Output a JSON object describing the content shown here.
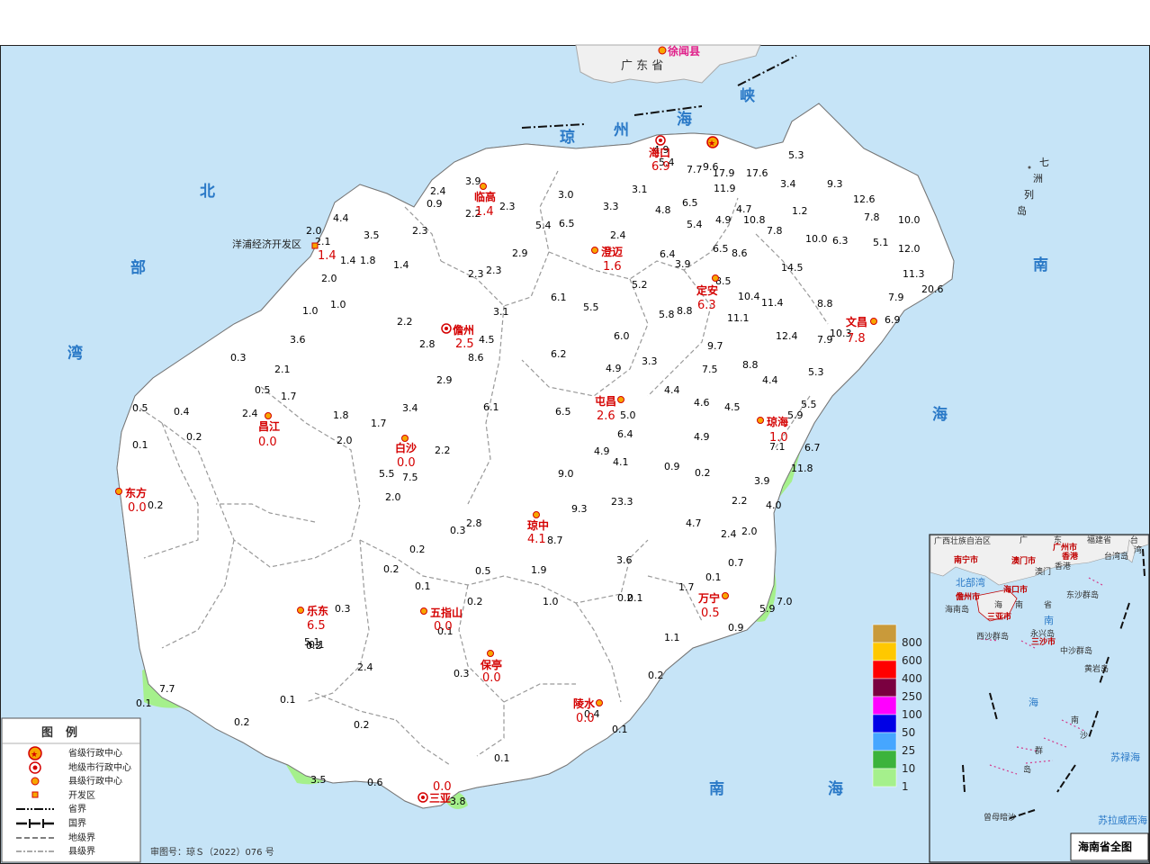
{
  "map": {
    "approval": "审图号：琼Ｓ（2022）076 号",
    "sea_labels": {
      "qiongzhou_strait": [
        "琼",
        "州",
        "海",
        "峡"
      ],
      "beibu_gulf": [
        "北",
        "部",
        "湾"
      ],
      "south_sea": [
        "南",
        "海"
      ],
      "south_sea_bottom": [
        "南",
        "海"
      ],
      "qizhou": [
        "七",
        "洲",
        "列",
        "岛"
      ]
    },
    "mainland": {
      "province": "广 东 省",
      "county": "徐闻县"
    },
    "dev_zone": "洋浦经济开发区",
    "cities": [
      {
        "name": "海口",
        "value": "6.9"
      },
      {
        "name": "临高",
        "value": "1.4"
      },
      {
        "name": "澄迈",
        "value": "1.6"
      },
      {
        "name": "定安",
        "value": "6.3"
      },
      {
        "name": "文昌",
        "value": "7.8"
      },
      {
        "name": "儋州",
        "value": "2.5"
      },
      {
        "name": "屯昌",
        "value": "2.6"
      },
      {
        "name": "琼海",
        "value": "1.0"
      },
      {
        "name": "昌江",
        "value": "0.0"
      },
      {
        "name": "白沙",
        "value": "0.0"
      },
      {
        "name": "东方",
        "value": "0.0"
      },
      {
        "name": "琼中",
        "value": "4.1"
      },
      {
        "name": "乐东",
        "value": "6.5"
      },
      {
        "name": "五指山",
        "value": "0.0"
      },
      {
        "name": "保亭",
        "value": "0.0"
      },
      {
        "name": "万宁",
        "value": "0.5"
      },
      {
        "name": "陵水",
        "value": "0.0"
      },
      {
        "name": "三亚",
        "value": "0.0"
      }
    ],
    "yangpu_value": "1.4",
    "station_values": [
      "4.9",
      "5.4",
      "7.7",
      "9.6",
      "17.9",
      "17.6",
      "11.9",
      "5.3",
      "3.4",
      "9.3",
      "12.6",
      "7.8",
      "10.0",
      "3.9",
      "2.4",
      "0.9",
      "2.2",
      "2.3",
      "3.0",
      "3.1",
      "3.3",
      "4.8",
      "6.5",
      "4.7",
      "1.2",
      "4.4",
      "3.5",
      "2.3",
      "5.4",
      "6.5",
      "2.4",
      "5.4",
      "4.9",
      "10.8",
      "7.8",
      "10.0",
      "6.3",
      "5.1",
      "12.0",
      "2.0",
      "2.1",
      "1.4",
      "1.8",
      "1.4",
      "2.9",
      "6.4",
      "6.5",
      "8.6",
      "14.5",
      "11.3",
      "20.6",
      "2.0",
      "2.3",
      "2.3",
      "3.9",
      "5.2",
      "8.5",
      "7.9",
      "1.0",
      "1.0",
      "6.1",
      "5.5",
      "3.1",
      "5.8",
      "8.8",
      "10.4",
      "11.4",
      "8.8",
      "11.1",
      "6.9",
      "10.3",
      "7.9",
      "12.4",
      "2.2",
      "3.6",
      "2.8",
      "4.5",
      "6.0",
      "9.7",
      "0.3",
      "8.6",
      "6.2",
      "4.9",
      "3.3",
      "7.5",
      "8.8",
      "5.3",
      "2.1",
      "0.5",
      "1.7",
      "2.9",
      "4.4",
      "4.4",
      "4.6",
      "4.5",
      "5.5",
      "5.9",
      "0.5",
      "0.4",
      "2.4",
      "1.8",
      "3.4",
      "6.1",
      "6.5",
      "5.0",
      "1.7",
      "7.1",
      "0.2",
      "2.0",
      "6.4",
      "4.9",
      "6.7",
      "0.1",
      "5.5",
      "2.2",
      "4.9",
      "4.1",
      "0.9",
      "0.2",
      "11.8",
      "7.5",
      "9.0",
      "3.9",
      "0.2",
      "2.0",
      "23.3",
      "2.2",
      "4.0",
      "9.3",
      "2.8",
      "4.7",
      "8.7",
      "0.3",
      "2.4",
      "2.0",
      "0.2",
      "0.5",
      "3.6",
      "0.7",
      "1.9",
      "0.2",
      "1.0",
      "0.1",
      "1.7",
      "0.1",
      "0.2",
      "0.2",
      "0.1",
      "0.3",
      "0.1",
      "0.1",
      "7.0",
      "5.1",
      "5.9",
      "0.2",
      "0.9",
      "1.1",
      "2.4",
      "0.3",
      "7.7",
      "0.2",
      "0.1",
      "0.1",
      "0.2",
      "0.2",
      "0.4",
      "0.1",
      "0.1",
      "3.5",
      "0.6",
      "3.8"
    ],
    "legend": {
      "title": "图例",
      "items": [
        "省级行政中心",
        "地级市行政中心",
        "县级行政中心",
        "开发区",
        "省界",
        "国界",
        "地级界",
        "县级界"
      ]
    },
    "scale": {
      "labels": [
        "800",
        "600",
        "400",
        "250",
        "100",
        "50",
        "25",
        "10",
        "1"
      ],
      "colors": [
        "#c99a3a",
        "#ffc800",
        "#ff0000",
        "#7a0040",
        "#ff00ff",
        "#0000e6",
        "#46a6ff",
        "#3cb33c",
        "#a5f08c"
      ]
    },
    "colors": {
      "sea": "#c6e4f7",
      "land_dry": "#ffffff",
      "rain_1_10": "#a5f08c",
      "rain_10_25": "#3cb33c",
      "mainland": "#f0f0f0"
    },
    "inset": {
      "title": "海南省全图",
      "labels": [
        "广西壮族自治区",
        "广",
        "东",
        "福建省",
        "台",
        "湾",
        "南宁市",
        "广州市",
        "香港",
        "澳门市",
        "澳门",
        "香港",
        "台湾岛",
        "北部湾",
        "海口市",
        "东沙群岛",
        "儋州市",
        "海",
        "南",
        "省",
        "海南岛",
        "三亚市",
        "南",
        "西沙群岛",
        "永兴岛",
        "三沙市",
        "中沙群岛",
        "黄岩岛",
        "海",
        "南",
        "沙",
        "群",
        "岛",
        "苏禄海",
        "曾母暗沙",
        "苏拉威西海"
      ]
    }
  }
}
